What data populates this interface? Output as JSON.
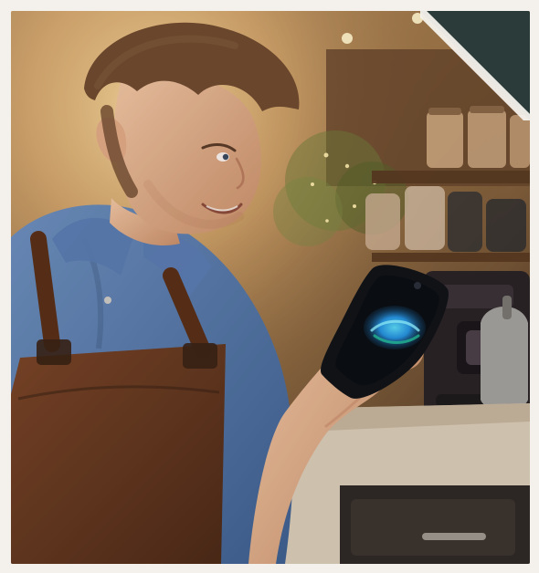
{
  "image": {
    "kind": "illustration",
    "subject": "barista-with-smartphone"
  },
  "colors": {
    "background_warm": "#b98956",
    "background_dark": "#3b2a1e",
    "shirt_blue": "#4f6e98",
    "apron_brown": "#6b3d22",
    "hair_brown": "#6f4a2f",
    "skin_tone": "#e3b18c",
    "phone_black": "#111318",
    "screen_glow": "#2aa6ff",
    "corner_teal": "#2b3b3a"
  }
}
